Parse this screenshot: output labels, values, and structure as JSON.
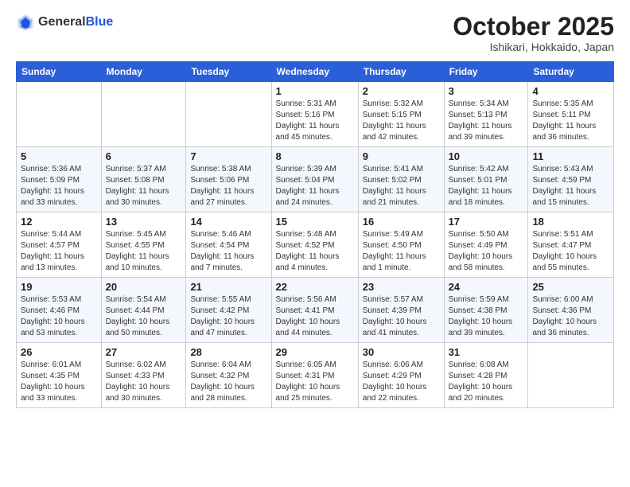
{
  "logo": {
    "general": "General",
    "blue": "Blue"
  },
  "title": "October 2025",
  "location": "Ishikari, Hokkaido, Japan",
  "weekdays": [
    "Sunday",
    "Monday",
    "Tuesday",
    "Wednesday",
    "Thursday",
    "Friday",
    "Saturday"
  ],
  "weeks": [
    [
      {
        "day": "",
        "info": ""
      },
      {
        "day": "",
        "info": ""
      },
      {
        "day": "",
        "info": ""
      },
      {
        "day": "1",
        "info": "Sunrise: 5:31 AM\nSunset: 5:16 PM\nDaylight: 11 hours\nand 45 minutes."
      },
      {
        "day": "2",
        "info": "Sunrise: 5:32 AM\nSunset: 5:15 PM\nDaylight: 11 hours\nand 42 minutes."
      },
      {
        "day": "3",
        "info": "Sunrise: 5:34 AM\nSunset: 5:13 PM\nDaylight: 11 hours\nand 39 minutes."
      },
      {
        "day": "4",
        "info": "Sunrise: 5:35 AM\nSunset: 5:11 PM\nDaylight: 11 hours\nand 36 minutes."
      }
    ],
    [
      {
        "day": "5",
        "info": "Sunrise: 5:36 AM\nSunset: 5:09 PM\nDaylight: 11 hours\nand 33 minutes."
      },
      {
        "day": "6",
        "info": "Sunrise: 5:37 AM\nSunset: 5:08 PM\nDaylight: 11 hours\nand 30 minutes."
      },
      {
        "day": "7",
        "info": "Sunrise: 5:38 AM\nSunset: 5:06 PM\nDaylight: 11 hours\nand 27 minutes."
      },
      {
        "day": "8",
        "info": "Sunrise: 5:39 AM\nSunset: 5:04 PM\nDaylight: 11 hours\nand 24 minutes."
      },
      {
        "day": "9",
        "info": "Sunrise: 5:41 AM\nSunset: 5:02 PM\nDaylight: 11 hours\nand 21 minutes."
      },
      {
        "day": "10",
        "info": "Sunrise: 5:42 AM\nSunset: 5:01 PM\nDaylight: 11 hours\nand 18 minutes."
      },
      {
        "day": "11",
        "info": "Sunrise: 5:43 AM\nSunset: 4:59 PM\nDaylight: 11 hours\nand 15 minutes."
      }
    ],
    [
      {
        "day": "12",
        "info": "Sunrise: 5:44 AM\nSunset: 4:57 PM\nDaylight: 11 hours\nand 13 minutes."
      },
      {
        "day": "13",
        "info": "Sunrise: 5:45 AM\nSunset: 4:55 PM\nDaylight: 11 hours\nand 10 minutes."
      },
      {
        "day": "14",
        "info": "Sunrise: 5:46 AM\nSunset: 4:54 PM\nDaylight: 11 hours\nand 7 minutes."
      },
      {
        "day": "15",
        "info": "Sunrise: 5:48 AM\nSunset: 4:52 PM\nDaylight: 11 hours\nand 4 minutes."
      },
      {
        "day": "16",
        "info": "Sunrise: 5:49 AM\nSunset: 4:50 PM\nDaylight: 11 hours\nand 1 minute."
      },
      {
        "day": "17",
        "info": "Sunrise: 5:50 AM\nSunset: 4:49 PM\nDaylight: 10 hours\nand 58 minutes."
      },
      {
        "day": "18",
        "info": "Sunrise: 5:51 AM\nSunset: 4:47 PM\nDaylight: 10 hours\nand 55 minutes."
      }
    ],
    [
      {
        "day": "19",
        "info": "Sunrise: 5:53 AM\nSunset: 4:46 PM\nDaylight: 10 hours\nand 53 minutes."
      },
      {
        "day": "20",
        "info": "Sunrise: 5:54 AM\nSunset: 4:44 PM\nDaylight: 10 hours\nand 50 minutes."
      },
      {
        "day": "21",
        "info": "Sunrise: 5:55 AM\nSunset: 4:42 PM\nDaylight: 10 hours\nand 47 minutes."
      },
      {
        "day": "22",
        "info": "Sunrise: 5:56 AM\nSunset: 4:41 PM\nDaylight: 10 hours\nand 44 minutes."
      },
      {
        "day": "23",
        "info": "Sunrise: 5:57 AM\nSunset: 4:39 PM\nDaylight: 10 hours\nand 41 minutes."
      },
      {
        "day": "24",
        "info": "Sunrise: 5:59 AM\nSunset: 4:38 PM\nDaylight: 10 hours\nand 39 minutes."
      },
      {
        "day": "25",
        "info": "Sunrise: 6:00 AM\nSunset: 4:36 PM\nDaylight: 10 hours\nand 36 minutes."
      }
    ],
    [
      {
        "day": "26",
        "info": "Sunrise: 6:01 AM\nSunset: 4:35 PM\nDaylight: 10 hours\nand 33 minutes."
      },
      {
        "day": "27",
        "info": "Sunrise: 6:02 AM\nSunset: 4:33 PM\nDaylight: 10 hours\nand 30 minutes."
      },
      {
        "day": "28",
        "info": "Sunrise: 6:04 AM\nSunset: 4:32 PM\nDaylight: 10 hours\nand 28 minutes."
      },
      {
        "day": "29",
        "info": "Sunrise: 6:05 AM\nSunset: 4:31 PM\nDaylight: 10 hours\nand 25 minutes."
      },
      {
        "day": "30",
        "info": "Sunrise: 6:06 AM\nSunset: 4:29 PM\nDaylight: 10 hours\nand 22 minutes."
      },
      {
        "day": "31",
        "info": "Sunrise: 6:08 AM\nSunset: 4:28 PM\nDaylight: 10 hours\nand 20 minutes."
      },
      {
        "day": "",
        "info": ""
      }
    ]
  ]
}
